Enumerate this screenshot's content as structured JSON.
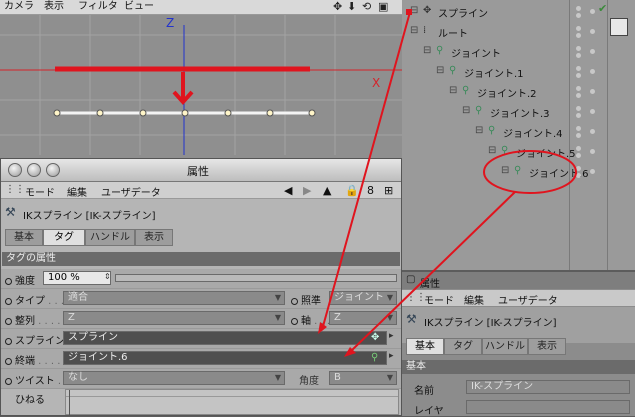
{
  "viewport": {
    "menu": [
      "カメラ",
      "表示",
      "フィルタ",
      "ビュー"
    ],
    "nav_icons": [
      "move-icon",
      "scale-icon",
      "rotate-icon",
      "maximize-icon"
    ],
    "axis_z": "Z",
    "axis_x": "X"
  },
  "object_manager": {
    "objects": [
      {
        "label": "スプライン",
        "icon": "spline-icon",
        "depth": 0
      },
      {
        "label": "ルート",
        "icon": "null-icon",
        "depth": 0
      },
      {
        "label": "ジョイント",
        "icon": "joint-icon",
        "depth": 1
      },
      {
        "label": "ジョイント.1",
        "icon": "joint-icon",
        "depth": 2
      },
      {
        "label": "ジョイント.2",
        "icon": "joint-icon",
        "depth": 3
      },
      {
        "label": "ジョイント.3",
        "icon": "joint-icon",
        "depth": 4
      },
      {
        "label": "ジョイント.4",
        "icon": "joint-icon",
        "depth": 5
      },
      {
        "label": "ジョイント.5",
        "icon": "joint-icon",
        "depth": 6
      },
      {
        "label": "ジョイント.6",
        "icon": "joint-icon",
        "depth": 7
      }
    ]
  },
  "attr_dialog": {
    "title": "属性",
    "menu": [
      "モード",
      "編集",
      "ユーザデータ"
    ],
    "object_title": "IKスプライン [IK-スプライン]",
    "tabs": [
      "基本",
      "タグ",
      "ハンドル",
      "表示"
    ],
    "active_tab": "タグ",
    "section": "タグの属性",
    "params": {
      "strength_label": "強度",
      "strength_value": "100 %",
      "strength_fraction": 1.0,
      "type_label": "タイプ",
      "type_value": "適合",
      "reference_label": "照準",
      "reference_value": "ジョイント",
      "align_label": "整列",
      "align_value": "Z",
      "axis_label": "軸",
      "axis_value": "Z",
      "spline_label": "スプライン",
      "spline_value": "スプライン",
      "end_label": "終端",
      "end_value": "ジョイント.6",
      "twist_label": "ツイスト",
      "twist_value": "なし",
      "angle_label": "角度",
      "angle_value": "B",
      "hineru_label": "ひねる"
    }
  },
  "attr_panel": {
    "title": "属性",
    "menu": [
      "モード",
      "編集",
      "ユーザデータ"
    ],
    "object_title": "IKスプライン [IK-スプライン]",
    "tabs": [
      "基本",
      "タグ",
      "ハンドル",
      "表示"
    ],
    "active_tab": "基本",
    "section": "基本",
    "name_label": "名前",
    "name_value": "IK-スプライン",
    "layer_label": "レイヤ"
  },
  "colors": {
    "annotation_red": "#e0141e",
    "axis_blue": "#2233cc",
    "axis_red": "#d4232a"
  }
}
